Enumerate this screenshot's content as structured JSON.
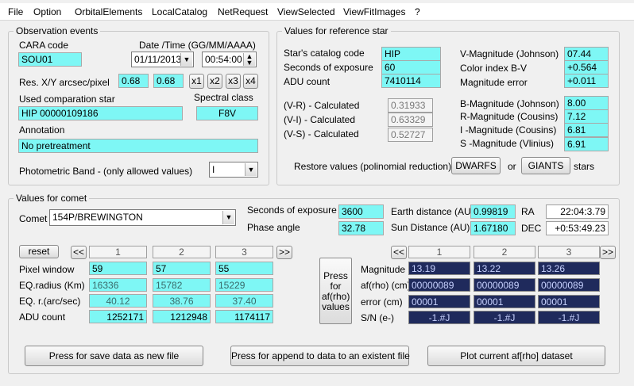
{
  "menu": [
    "File",
    "Option",
    "OrbitalElements",
    "LocalCatalog",
    "NetRequest",
    "ViewSelected",
    "ViewFitImages",
    "?"
  ],
  "obs": {
    "title": "Observation events",
    "cara_label": "CARA code",
    "cara_value": "SOU01",
    "datetime_label": "Date /Time  (GG/MM/AAAA)",
    "date_value": "01/11/2013",
    "time_value": "00:54:00",
    "res_label": "Res. X/Y arcsec/pixel",
    "res_x": "0.68",
    "res_y": "0.68",
    "zoom_buttons": [
      "x1",
      "x2",
      "x3",
      "x4"
    ],
    "comp_star_label": "Used comparation star",
    "comp_star_value": "HIP 00000109186",
    "spectral_label": "Spectral class",
    "spectral_value": "F8V",
    "annotation_label": "Annotation",
    "annotation_value": "No pretreatment",
    "band_label": "Photometric Band  - (only allowed values)",
    "band_value": "I"
  },
  "ref": {
    "title": "Values for reference star",
    "catalog_label": "Star's catalog code",
    "catalog_value": "HIP",
    "exposure_label": "Seconds of exposure",
    "exposure_value": "60",
    "adu_label": "ADU count",
    "adu_value": "7410114",
    "vr_label": "(V-R) - Calculated",
    "vr_value": "0.31933",
    "vi_label": "(V-I) -  Calculated",
    "vi_value": "0.63329",
    "vs_label": "(V-S) - Calculated",
    "vs_value": "0.52727",
    "vmag_label": "V-Magnitude (Johnson)",
    "vmag_value": "07.44",
    "bv_label": "Color index B-V",
    "bv_value": "+0.564",
    "magerr_label": "Magnitude error",
    "magerr_value": "+0.011",
    "bmag_label": "B-Magnitude (Johnson)",
    "bmag_value": "8.00",
    "rmag_label": "R-Magnitude (Cousins)",
    "rmag_value": "7.12",
    "imag_label": "I -Magnitude (Cousins)",
    "imag_value": "6.81",
    "smag_label": "S -Magnitude (Vlinius)",
    "smag_value": "6.91",
    "restore_label": "Restore values (polinomial reduction) for",
    "dwarfs_label": "DWARFS",
    "or_label": "or",
    "giants_label": "GIANTS",
    "stars_label": "stars"
  },
  "comet": {
    "title": "Values for comet",
    "comet_label": "Comet",
    "comet_value": "154P/BREWINGTON",
    "exposure_label": "Seconds of exposure",
    "exposure_value": "3600",
    "phase_label": "Phase angle",
    "phase_value": "32.78",
    "earth_label": "Earth distance (AU)",
    "earth_value": "0.99819",
    "sun_label": "Sun Distance (AU)",
    "sun_value": "1.67180",
    "ra_label": "RA",
    "ra_value": "22:04:3.79",
    "dec_label": "DEC",
    "dec_value": "+0:53:49.23",
    "reset_label": "reset",
    "prev_label": "<<",
    "next_label": ">>",
    "columns": [
      "1",
      "2",
      "3"
    ],
    "row_labels": [
      "Pixel window",
      "EQ.radius (Km)",
      "EQ. r.(arc/sec)",
      "ADU count"
    ],
    "pixel_window": [
      "59",
      "57",
      "55"
    ],
    "eq_radius_km": [
      "16336",
      "15782",
      "15229"
    ],
    "eq_radius_arcsec": [
      "40.12",
      "38.76",
      "37.40"
    ],
    "adu_count": [
      "1252171",
      "1212948",
      "1174117"
    ],
    "press_label": "Press for af(rho) values",
    "right_row_labels": [
      "Magnitude",
      "af(rho) (cm)",
      "error (cm)",
      "S/N (e-)"
    ],
    "magnitude": [
      "13.19",
      "13.22",
      "13.26"
    ],
    "afrho": [
      "00000089",
      "00000089",
      "00000089"
    ],
    "error": [
      "00001",
      "00001",
      "00001"
    ],
    "sn": [
      "-1.#J",
      "-1.#J",
      "-1.#J"
    ]
  },
  "bottom": {
    "save_label": "Press for save data as new file",
    "append_label": "Press for append to  data to an existent file",
    "plot_label": "Plot current af[rho] dataset"
  }
}
